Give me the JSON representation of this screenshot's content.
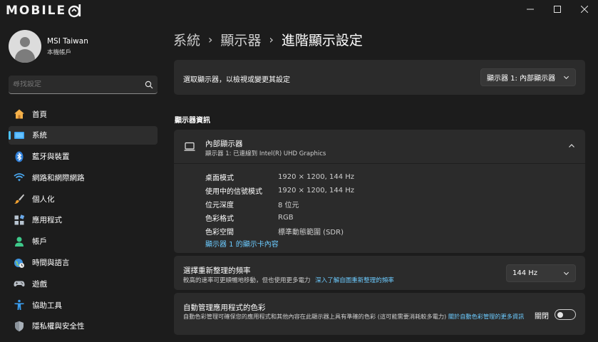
{
  "window": {
    "logo_text": "MOBILE",
    "minimize_glyph": "—",
    "maximize_glyph": "☐",
    "close_glyph": "✕"
  },
  "profile": {
    "name": "MSI Taiwan",
    "account_type": "本機帳戶"
  },
  "search": {
    "placeholder": "尋找設定",
    "icon": "search-icon"
  },
  "sidebar": {
    "items": [
      {
        "label": "首頁",
        "icon": "home-icon",
        "active": false
      },
      {
        "label": "系統",
        "icon": "system-icon",
        "active": true
      },
      {
        "label": "藍牙與裝置",
        "icon": "bluetooth-icon",
        "active": false
      },
      {
        "label": "網路和網際網路",
        "icon": "wifi-icon",
        "active": false
      },
      {
        "label": "個人化",
        "icon": "brush-icon",
        "active": false
      },
      {
        "label": "應用程式",
        "icon": "apps-icon",
        "active": false
      },
      {
        "label": "帳戶",
        "icon": "account-icon",
        "active": false
      },
      {
        "label": "時間與語言",
        "icon": "globe-clock-icon",
        "active": false
      },
      {
        "label": "遊戲",
        "icon": "gamepad-icon",
        "active": false
      },
      {
        "label": "協助工具",
        "icon": "accessibility-icon",
        "active": false
      },
      {
        "label": "隱私權與安全性",
        "icon": "shield-icon",
        "active": false
      }
    ]
  },
  "breadcrumb": {
    "part1": "系統",
    "part2": "顯示器",
    "current": "進階顯示設定",
    "separator": "›"
  },
  "select_display": {
    "label": "選取顯示器，以檢視或變更其設定",
    "value": "顯示器 1: 內部顯示器"
  },
  "display_info": {
    "section_title": "顯示器資訊",
    "title": "內部顯示器",
    "subtitle": "顯示器 1: 已連線到 Intel(R) UHD Graphics",
    "specs": [
      {
        "label": "桌面模式",
        "value": "1920 × 1200, 144 Hz"
      },
      {
        "label": "使用中的信號模式",
        "value": "1920 × 1200, 144 Hz"
      },
      {
        "label": "位元深度",
        "value": "8 位元"
      },
      {
        "label": "色彩格式",
        "value": "RGB"
      },
      {
        "label": "色彩空間",
        "value": "標準動態範圍 (SDR)"
      }
    ],
    "adapter_link": "顯示器 1 的顯示卡內容"
  },
  "refresh_rate": {
    "title": "選擇重新整理的頻率",
    "description": "較高的速率可更順暢地移動，但也使用更多電力",
    "link": "深入了解自圖重新整理的頻率",
    "value": "144 Hz"
  },
  "color_management": {
    "title": "自動管理應用程式的色彩",
    "description": "自動色彩管理可確保您的應用程式和其他內容在此顯示器上具有準確的色彩 (這可能需要消耗較多電力)",
    "link": "關於自動色彩管理的更多資訊",
    "toggle_label": "關閉",
    "toggle_on": false
  },
  "colors": {
    "accent": "#4cc2ff",
    "link": "#6ccbff",
    "card": "#2b2b2b",
    "background": "#1c1c1c"
  }
}
